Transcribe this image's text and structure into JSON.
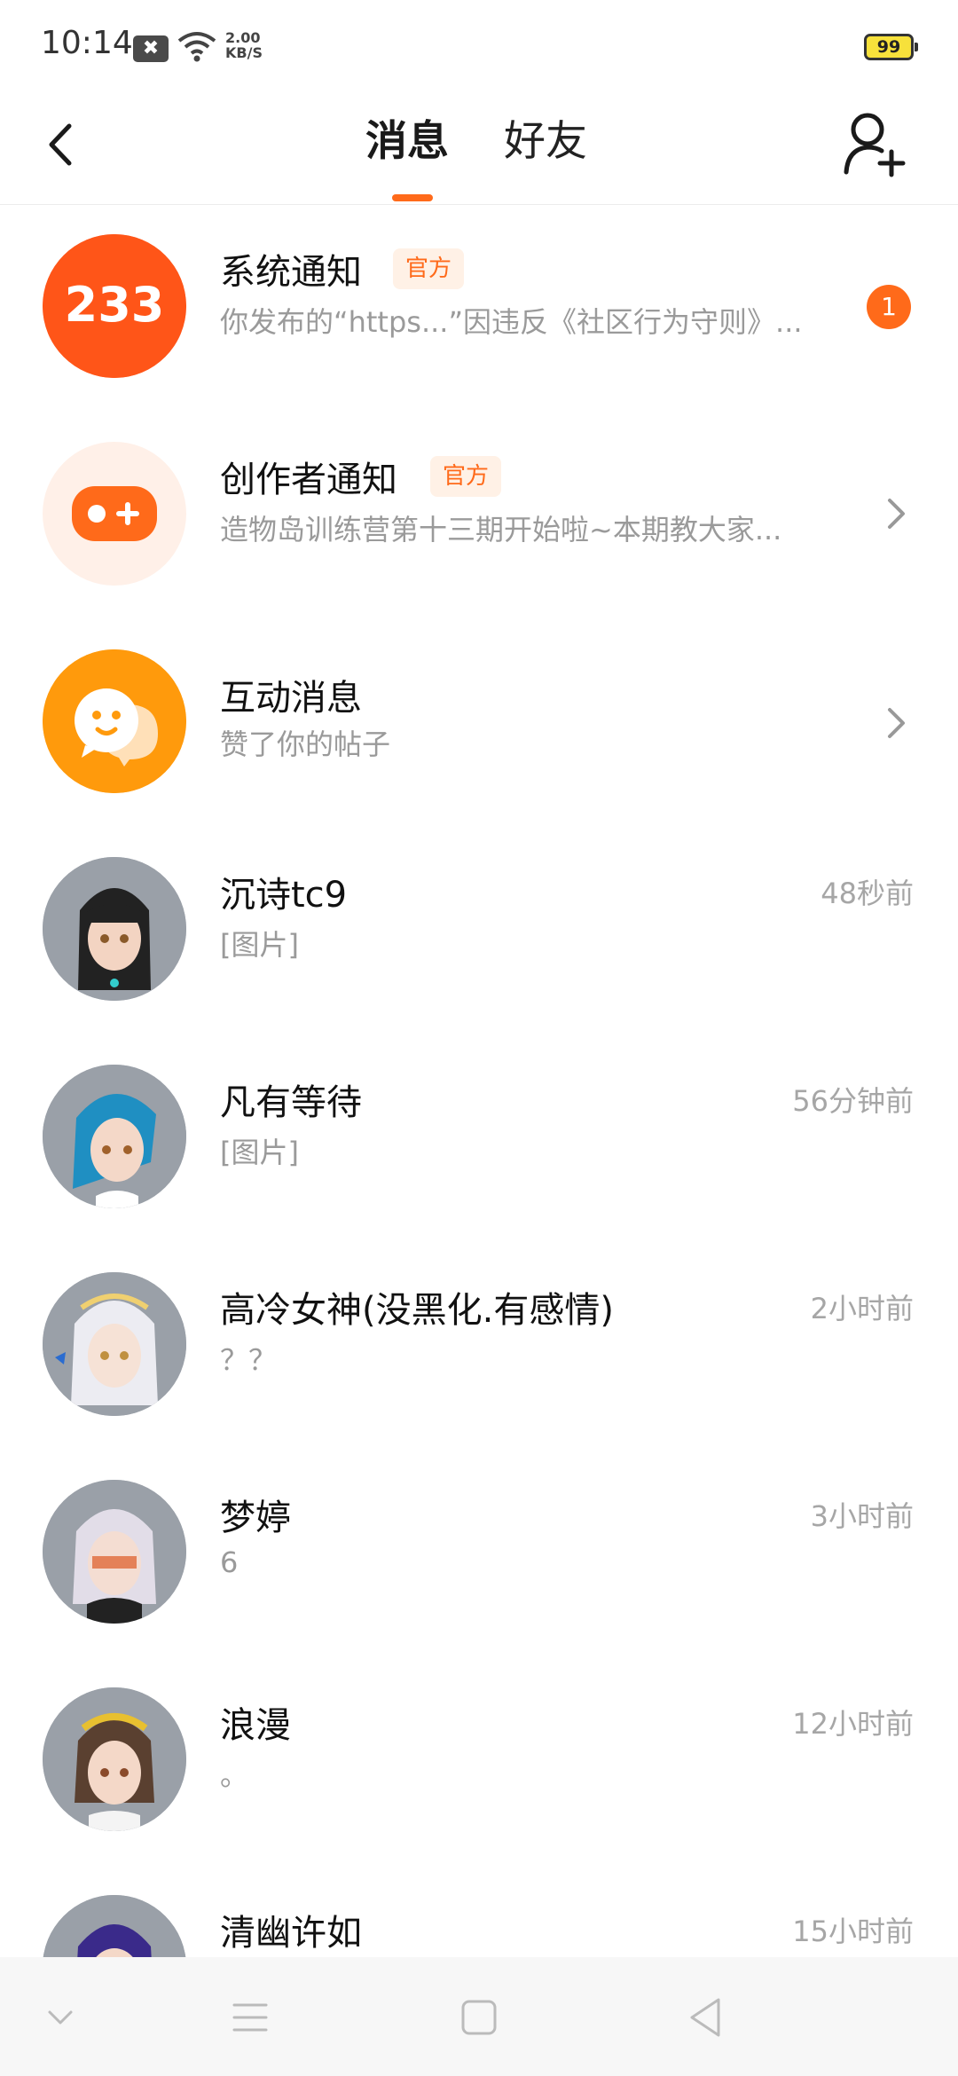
{
  "status_bar": {
    "time": "10:14",
    "net_speed_value": "2.00",
    "net_speed_unit": "KB/S",
    "battery": "99"
  },
  "header": {
    "tabs": [
      {
        "label": "消息",
        "active": true
      },
      {
        "label": "好友",
        "active": false
      }
    ]
  },
  "conversations": [
    {
      "name": "系统通知",
      "badge": "官方",
      "preview": "你发布的“https...”因违反《社区行为守则》...",
      "unread": "1",
      "avatar_icon": "233-logo-icon"
    },
    {
      "name": "创作者通知",
      "badge": "官方",
      "preview": "造物岛训练营第十三期开始啦~本期教大家...",
      "avatar_icon": "gamepad-icon"
    },
    {
      "name": "互动消息",
      "preview": "赞了你的帖子",
      "avatar_icon": "smile-chat-icon"
    },
    {
      "name": "沉诗tc9",
      "preview": "[图片]",
      "time": "48秒前"
    },
    {
      "name": "凡有等待",
      "preview": "[图片]",
      "time": "56分钟前"
    },
    {
      "name": "高冷女神(没黑化.有感情)",
      "preview": "？？",
      "time": "2小时前"
    },
    {
      "name": "梦婷",
      "preview": "6",
      "time": "3小时前"
    },
    {
      "name": "浪漫",
      "preview": "。",
      "time": "12小时前"
    },
    {
      "name": "清幽许如",
      "preview": "",
      "time": "15小时前"
    }
  ],
  "colors": {
    "accent": "#ff6a1a",
    "badge_bg": "#fff1e6"
  },
  "icons": {
    "back": "chevron-left-icon",
    "add_friend": "add-user-icon",
    "nav": [
      "chevron-down-icon",
      "menu-icon",
      "home-square-icon",
      "back-triangle-icon"
    ]
  }
}
